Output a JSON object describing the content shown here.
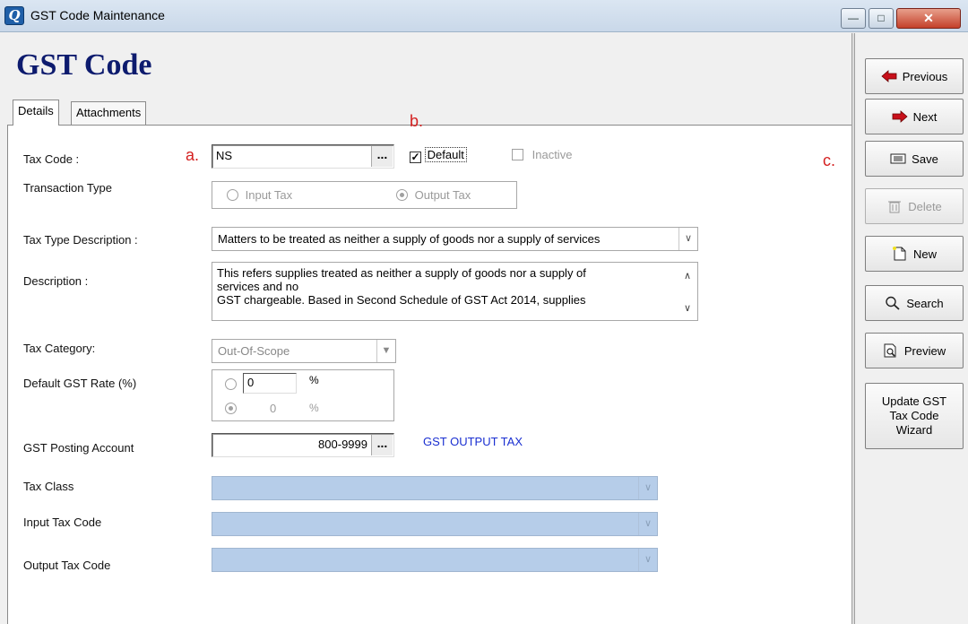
{
  "window": {
    "title": "GST Code Maintenance",
    "icon": "app-q-icon",
    "controls": [
      "minimize",
      "maximize",
      "close"
    ]
  },
  "page": {
    "title": "GST Code"
  },
  "tabs": [
    {
      "label": "Details",
      "active": true
    },
    {
      "label": "Attachments",
      "active": false
    }
  ],
  "markers": {
    "a": "a.",
    "b": "b.",
    "c": "c."
  },
  "form": {
    "tax_code": {
      "label": "Tax Code :",
      "value": "NS"
    },
    "default_checkbox": {
      "label": "Default",
      "checked": true
    },
    "inactive_checkbox": {
      "label": "Inactive",
      "checked": false,
      "enabled": false
    },
    "transaction_type": {
      "label": "Transaction Type",
      "options": [
        "Input Tax",
        "Output Tax"
      ],
      "selected": "Output Tax"
    },
    "tax_type_description": {
      "label": "Tax Type Description :",
      "value": "Matters to be treated as neither a supply of goods nor a supply of services"
    },
    "description": {
      "label": "Description :",
      "lines": [
        "This refers supplies treated as neither a supply of goods nor a supply of",
        "services and no",
        "GST chargeable. Based in Second Schedule of GST Act 2014, supplies"
      ]
    },
    "tax_category": {
      "label": "Tax Category:",
      "value": "Out-Of-Scope"
    },
    "default_gst_rate": {
      "label": "Default GST Rate (%)",
      "custom_value": "0",
      "fixed_value": "0",
      "percent": "%",
      "selected": "fixed"
    },
    "gst_posting_account": {
      "label": "GST Posting Account",
      "value": "800-9999",
      "account_name": "GST OUTPUT TAX"
    },
    "tax_class": {
      "label": "Tax Class",
      "value": ""
    },
    "input_tax_code": {
      "label": "Input Tax Code",
      "value": ""
    },
    "output_tax_code": {
      "label": "Output Tax Code",
      "value": ""
    }
  },
  "toolbar": {
    "previous": "Previous",
    "next": "Next",
    "save": "Save",
    "delete": "Delete",
    "new": "New",
    "search": "Search",
    "preview": "Preview",
    "update_wizard_1": "Update GST",
    "update_wizard_2": "Tax Code",
    "update_wizard_3": "Wizard"
  },
  "colors": {
    "title_blue": "#0d1b6e",
    "marker_red": "#d42020",
    "link_blue": "#1a2fd1",
    "disabled_combo_blue": "#b6cde9"
  }
}
